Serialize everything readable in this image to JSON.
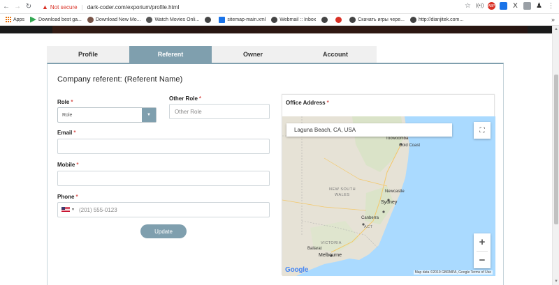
{
  "browser": {
    "warning_text": "Not secure",
    "url": "dark-coder.com/exporium/profile.html",
    "bookmarks": [
      {
        "label": "Apps",
        "color": "#e8710a"
      },
      {
        "label": "Download best ga...",
        "color": "#34a853"
      },
      {
        "label": "Download New Mo...",
        "color": "#795548"
      },
      {
        "label": "Watch Movies Onli...",
        "color": "#555555"
      },
      {
        "label": "",
        "color": "#444444"
      },
      {
        "label": "sitemap-main.xml",
        "color": "#1a73e8"
      },
      {
        "label": "Webmail :: Inbox",
        "color": "#444444"
      },
      {
        "label": "",
        "color": "#444444"
      },
      {
        "label": "",
        "color": "#d93025"
      },
      {
        "label": "Скачать игры чере...",
        "color": "#444444"
      },
      {
        "label": "http://dianjitek.com...",
        "color": "#444444"
      }
    ]
  },
  "tabs": [
    {
      "label": "Profile",
      "active": false
    },
    {
      "label": "Referent",
      "active": true
    },
    {
      "label": "Owner",
      "active": false
    },
    {
      "label": "Account",
      "active": false
    }
  ],
  "form": {
    "title": "Company referent: (Referent Name)",
    "role_label": "Role",
    "role_value": "Role",
    "other_role_label": "Other Role",
    "other_role_placeholder": "Other Role",
    "email_label": "Email",
    "email_value": "",
    "mobile_label": "Mobile",
    "mobile_value": "",
    "phone_label": "Phone",
    "phone_placeholder": "(201) 555-0123",
    "required_marker": "*",
    "update_label": "Update"
  },
  "office": {
    "label": "Office Address",
    "search_value": "Laguna Beach, CA, USA",
    "map_labels": {
      "toowoomba": "Toowoomba",
      "gold_coast": "Gold Coast",
      "nsw": "NEW SOUTH",
      "wales": "WALES",
      "newcastle": "Newcastle",
      "sydney": "Sydney",
      "canberra": "Canberra",
      "act": "ACT",
      "victoria": "VICTORIA",
      "ballarat": "Ballarat",
      "melbourne": "Melbourne"
    },
    "google": "Google",
    "attribution": "Map data ©2019 GBRMPA, Google   Terms of Use"
  },
  "colors": {
    "accent": "#7f9fae",
    "required": "#d9534f",
    "warning": "#d93025",
    "ocean": "#aadaff",
    "land": "#e8e4d8"
  }
}
